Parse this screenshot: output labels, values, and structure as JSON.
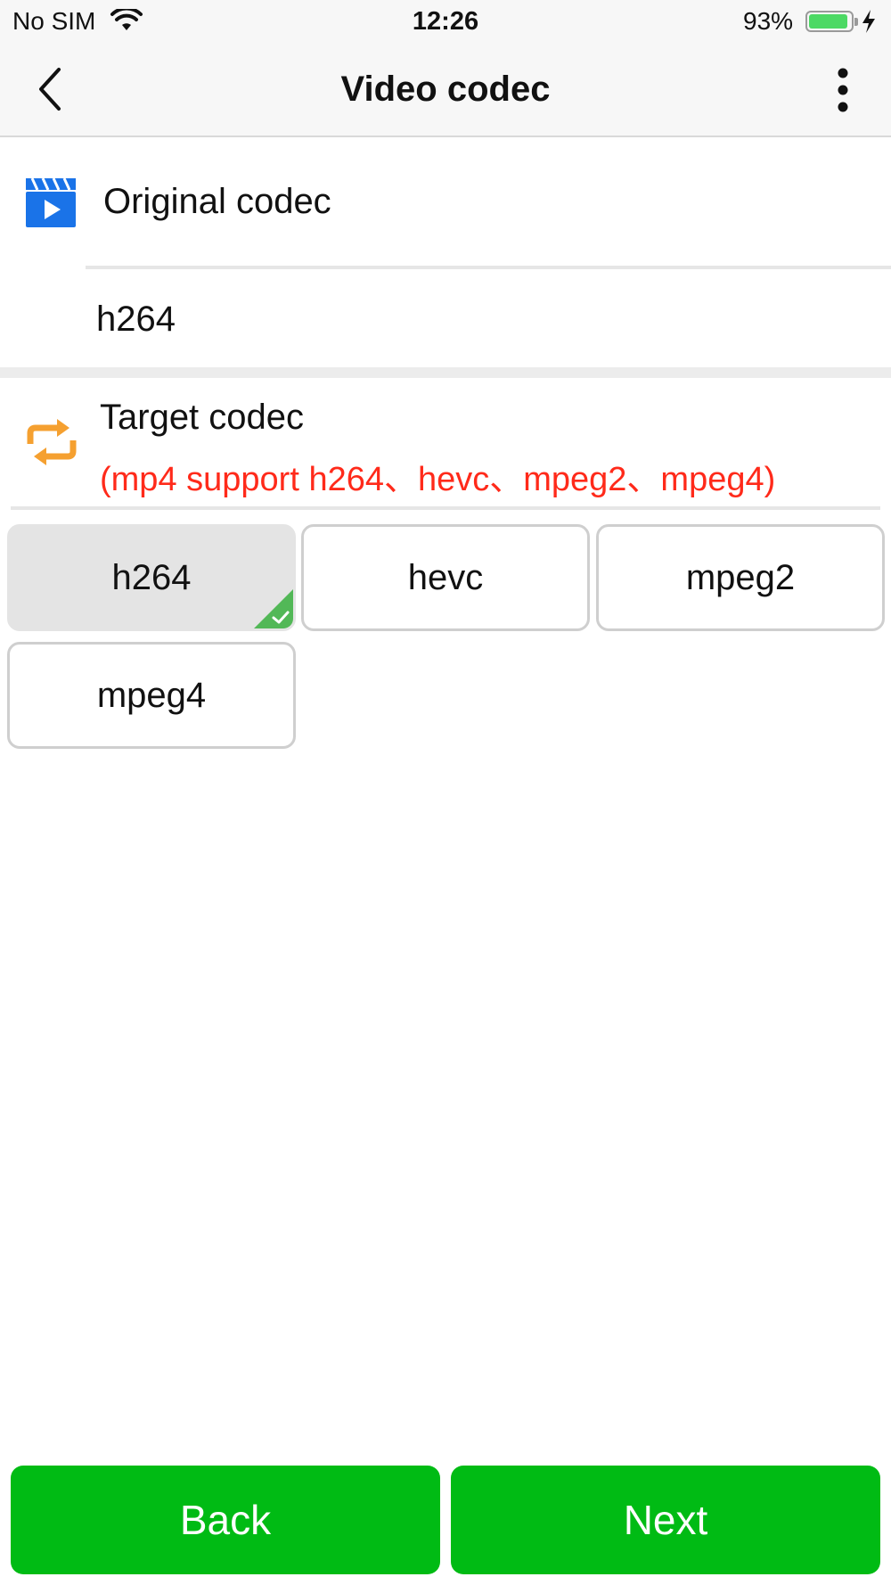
{
  "status_bar": {
    "carrier": "No SIM",
    "time": "12:26",
    "battery_percent": "93%",
    "battery_level": 0.93,
    "icons": [
      "wifi-icon",
      "battery-icon",
      "charging-bolt-icon"
    ]
  },
  "nav": {
    "title": "Video codec",
    "back_icon": "chevron-left-icon",
    "more_icon": "more-vertical-icon"
  },
  "original": {
    "label": "Original codec",
    "icon": "video-clapper-icon",
    "value": "h264"
  },
  "target": {
    "label": "Target codec",
    "note": "(mp4 support h264、hevc、mpeg2、mpeg4)",
    "icon": "convert-arrows-icon",
    "options": [
      "h264",
      "hevc",
      "mpeg2",
      "mpeg4"
    ],
    "selected": "h264"
  },
  "actions": {
    "back_label": "Back",
    "next_label": "Next"
  },
  "colors": {
    "accent_green": "#00bb14",
    "note_red": "#ff2a1a",
    "icon_blue": "#1a73e8",
    "icon_orange": "#f5a030",
    "check_green": "#52b857"
  }
}
